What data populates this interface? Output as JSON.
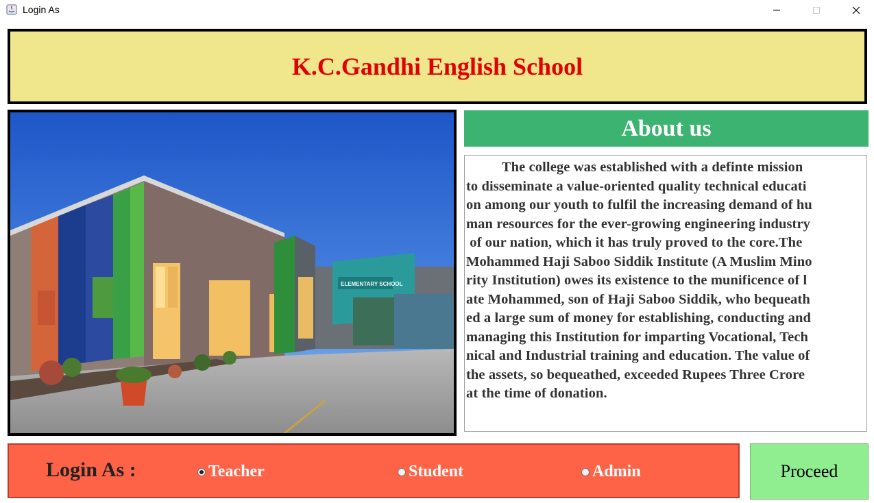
{
  "window": {
    "title": "Login As"
  },
  "header": {
    "school_name": "K.C.Gandhi English School"
  },
  "photo": {
    "sign_text": "ELEMENTARY SCHOOL"
  },
  "about": {
    "title": "About us",
    "lines": [
      "          The college was established with a definte mission",
      "to disseminate a value-oriented quality technical educati",
      "on among our youth to fulfil the increasing demand of hu",
      "man resources for the ever-growing engineering industry",
      " of our nation, which it has truly proved to the core.The",
      "Mohammed Haji Saboo Siddik Institute (A Muslim Mino",
      "rity Institution) owes its existence to the munificence of l",
      "ate Mohammed, son of Haji Saboo Siddik, who bequeath",
      "ed a large sum of money for establishing, conducting and",
      "managing this Institution for imparting Vocational, Tech",
      "nical and Industrial training and education. The value of",
      "the assets, so bequeathed, exceeded Rupees Three Crore",
      "at the time of donation."
    ]
  },
  "login": {
    "label": "Login As :",
    "options": [
      {
        "label": "Teacher",
        "selected": true
      },
      {
        "label": "Student",
        "selected": false
      },
      {
        "label": "Admin",
        "selected": false
      }
    ],
    "proceed_label": "Proceed"
  },
  "colors": {
    "header_bg": "#f0e68c",
    "school_name": "#e00000",
    "about_bg": "#3cb371",
    "login_bg": "#ff6347",
    "proceed_bg": "#90ee90"
  }
}
